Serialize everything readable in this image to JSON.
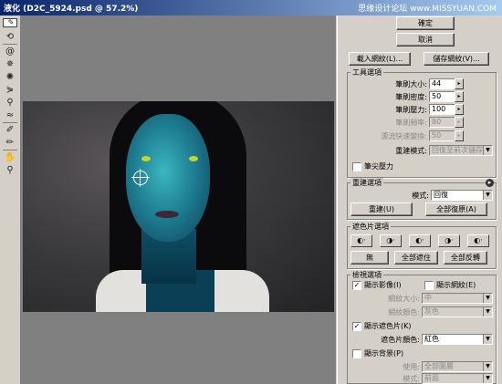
{
  "window": {
    "title": "液化 (D2C_5924.psd @ 57.2%)",
    "watermark": "思缘设计论坛 www.MISSYUAN.COM"
  },
  "tools": [
    "warp-tool",
    "reconstruct-tool",
    "twirl-tool",
    "pucker-tool",
    "bloat-tool",
    "push-left-tool",
    "mirror-tool",
    "turbulence-tool",
    "freeze-mask-tool",
    "thaw-mask-tool",
    "hand-tool",
    "zoom-tool"
  ],
  "buttons": {
    "ok": "確定",
    "cancel": "取消",
    "load_mesh": "載入網紋(L)...",
    "save_mesh": "儲存網紋(V)..."
  },
  "tool_options": {
    "title": "工具選項",
    "brush_size": {
      "label": "筆刷大小:",
      "value": "44"
    },
    "brush_density": {
      "label": "筆刷密度:",
      "value": "50"
    },
    "brush_pressure": {
      "label": "筆刷壓力:",
      "value": "100"
    },
    "brush_rate": {
      "label": "筆刷頻率:",
      "value": "80"
    },
    "turbulent_jitter": {
      "label": "漂流快速變換:",
      "value": "50"
    },
    "reconstruct_mode": {
      "label": "重建模式:",
      "value": "回復至前次儲存"
    },
    "stylus_pressure": {
      "label": "筆尖壓力",
      "checked": false
    }
  },
  "reconstruct_options": {
    "title": "重建選項",
    "mode": {
      "label": "模式:",
      "value": "回復"
    },
    "reconstruct": "重建(U)",
    "restore_all": "全部復原(A)"
  },
  "mask_options": {
    "title": "遮色片選項",
    "mode_buttons": [
      "◐·",
      "◑·",
      "◐·",
      "◑·",
      "◐·"
    ],
    "none": "無",
    "mask_all": "全部遮住",
    "invert_all": "全部反轉"
  },
  "view_options": {
    "title": "檢視選項",
    "show_image": {
      "label": "顯示影像(I)",
      "checked": true
    },
    "show_mesh": {
      "label": "顯示網紋(E)",
      "checked": false
    },
    "mesh_size": {
      "label": "網紋大小:",
      "value": "中"
    },
    "mesh_color": {
      "label": "網紋顏色:",
      "value": "灰色"
    },
    "show_mask": {
      "label": "顯示遮色片(K)",
      "checked": true
    },
    "mask_color": {
      "label": "遮色片顏色:",
      "value": "紅色"
    },
    "show_backdrop": {
      "label": "顯示背景(P)",
      "checked": false
    },
    "use": {
      "label": "使用:",
      "value": "全部圖層"
    },
    "bg_mode": {
      "label": "模式:",
      "value": "前面"
    }
  },
  "colors": {
    "titlebar_start": "#0a246a",
    "titlebar_end": "#a6caf0",
    "panel_bg": "#d4d0c8",
    "canvas_bg": "#808080"
  }
}
